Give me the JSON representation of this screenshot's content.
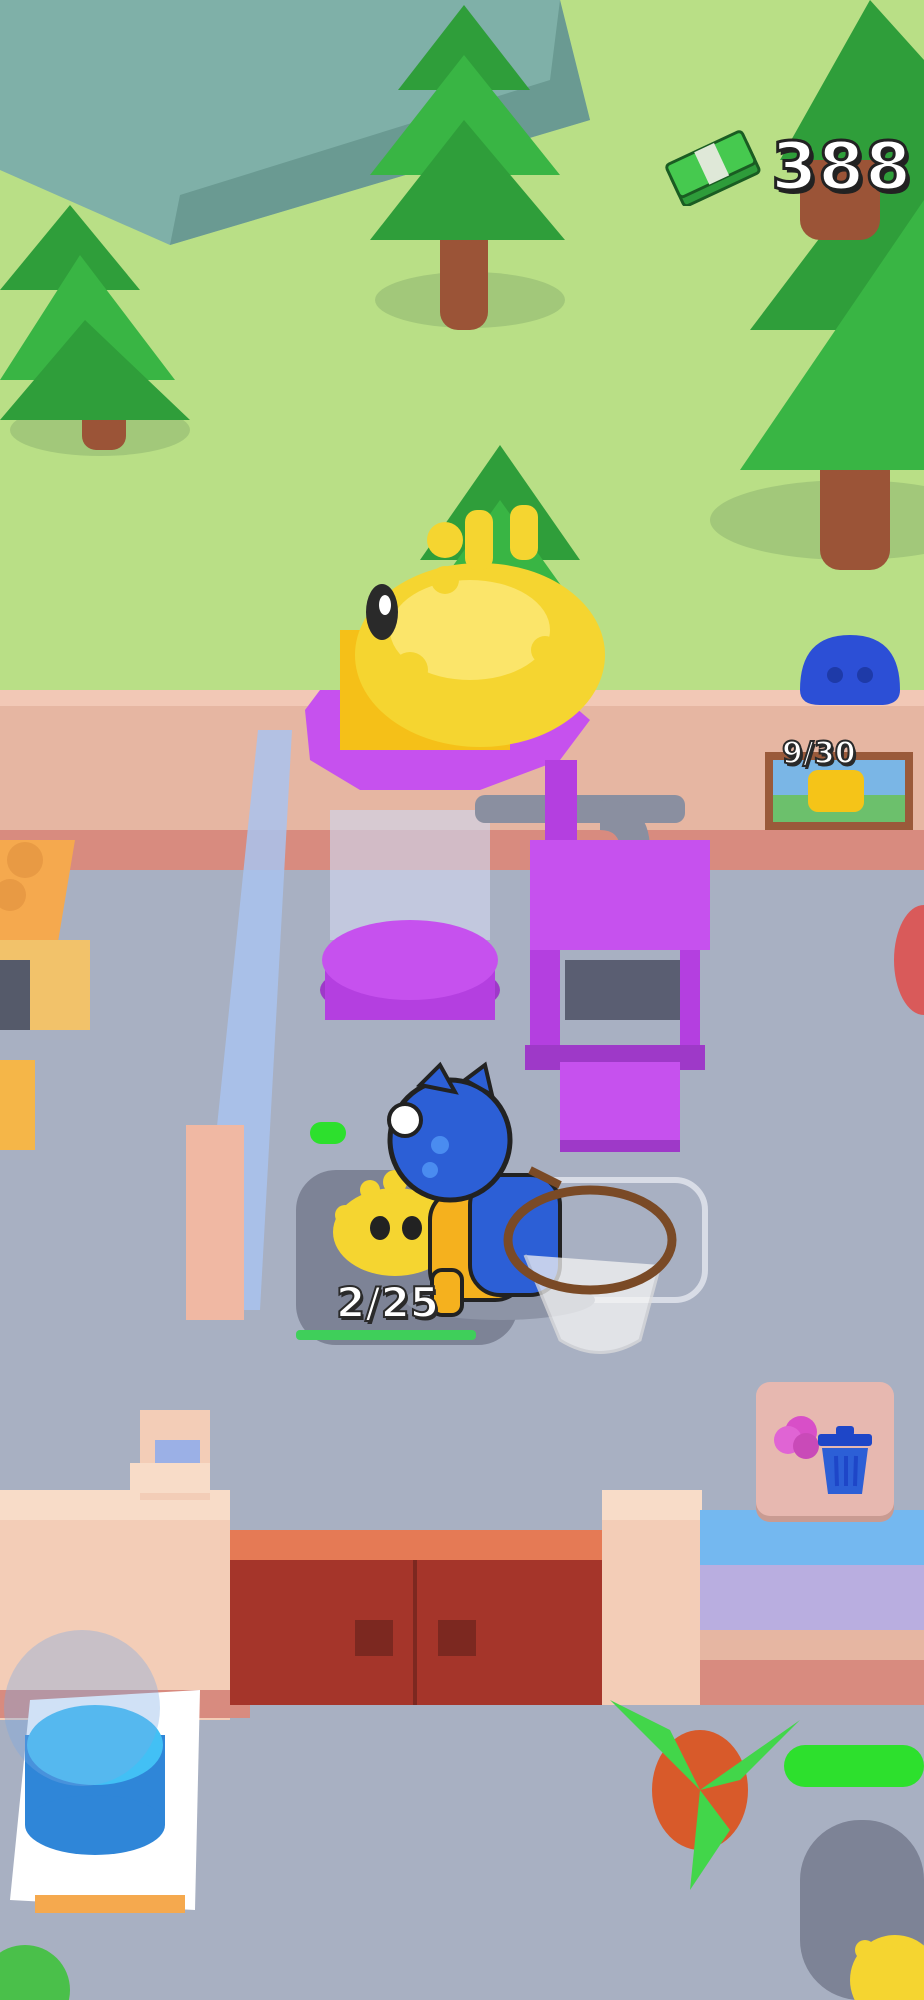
{
  "hud": {
    "cash_icon": "cash-stack-icon",
    "cash_amount": "388"
  },
  "storage": {
    "icon": "blue-monster-icon",
    "capacity_text": "9/30"
  },
  "carry": {
    "count_text": "2/25"
  },
  "trash_button": {
    "icon": "trash-can-icon"
  },
  "joystick": {
    "icon": "joystick-knob"
  },
  "colors": {
    "grass": "#b9df86",
    "floor": "#a8b0c2",
    "wall": "#e6b6a2",
    "purple_machine": "#b43fe0",
    "blue_character": "#2c5fd6",
    "yellow_monster": "#f5d530",
    "progress_green": "#2de02d"
  }
}
